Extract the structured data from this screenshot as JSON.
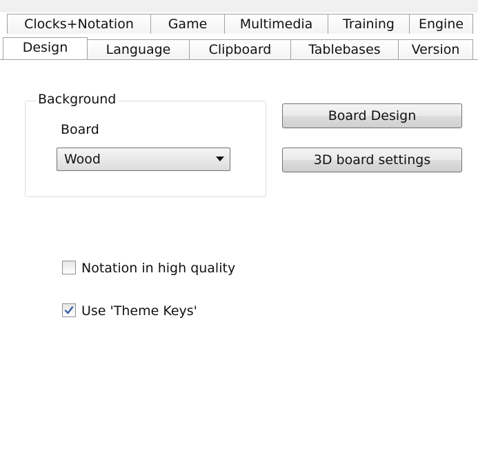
{
  "tabs": {
    "row1": [
      "Clocks+Notation",
      "Game",
      "Multimedia",
      "Training",
      "Engine"
    ],
    "row2": [
      "Design",
      "Language",
      "Clipboard",
      "Tablebases",
      "Version"
    ],
    "active": "Design"
  },
  "background_group": {
    "title": "Background",
    "board_label": "Board",
    "board_select": {
      "value": "Wood"
    }
  },
  "buttons": {
    "board_design": "Board Design",
    "board_3d_settings": "3D board settings"
  },
  "options": {
    "notation_high_quality": {
      "label": "Notation in high quality",
      "checked": false
    },
    "use_theme_keys": {
      "label": "Use 'Theme Keys'",
      "checked": true
    }
  },
  "icons": {
    "dropdown": "chevron-down-icon",
    "check": "checkmark-icon"
  },
  "colors": {
    "check_mark": "#3a5fa8",
    "group_border": "#d5dfe5"
  }
}
